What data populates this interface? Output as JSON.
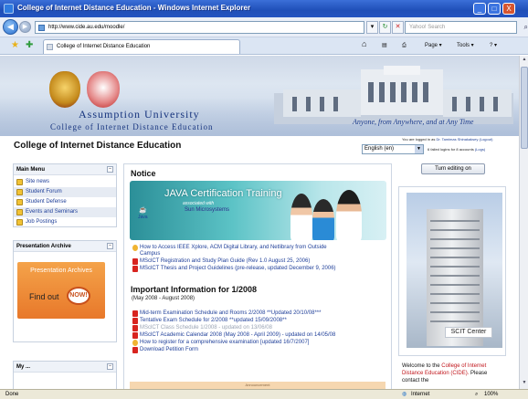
{
  "window": {
    "title": "College of Internet Distance Education - Windows Internet Explorer",
    "min_glyph": "_",
    "max_glyph": "□",
    "close_glyph": "X"
  },
  "address_bar": {
    "back_glyph": "◀",
    "forward_glyph": "▶",
    "url": "http://www.cide.au.edu/moodle/",
    "go_glyph": "▾",
    "refresh_glyph": "↻",
    "stop_glyph": "✕",
    "search_placeholder": "Yahoo! Search",
    "search_glyph": "⌕"
  },
  "tab_bar": {
    "tab_title": "College of Internet Distance Education",
    "home_glyph": "⌂",
    "feeds_glyph": "▤",
    "print_glyph": "⎙",
    "page_label": "Page ▾",
    "tools_label": "Tools ▾",
    "help_glyph": "? ▾"
  },
  "banner": {
    "university_name": "Assumption University",
    "college_name": "College of Internet Distance Education",
    "slogan": "Anyone, from Anywhere, and at Any Time"
  },
  "header": {
    "site_name": "College of Internet Distance Education",
    "login_text": "You are logged in as",
    "login_user": "Dr. Tamimas Shinakaksey (Logout)",
    "language": "English (en)",
    "failed_logins": "6 failed logins for 8 accounts",
    "failed_logins_link": "(Logs)"
  },
  "main_menu": {
    "title": "Main Menu",
    "items": [
      {
        "label": "Site news"
      },
      {
        "label": "Student Forum"
      },
      {
        "label": "Student Defense"
      },
      {
        "label": "Events and Seminars"
      },
      {
        "label": "Job Postings"
      }
    ]
  },
  "presentation_archive": {
    "title": "Presentation Archive",
    "banner_title": "Presentation Archives",
    "find_out": "Find out",
    "now": "NOW!"
  },
  "my_block": {
    "title": "My ..."
  },
  "notice": {
    "title": "Notice",
    "java_title": "JAVA Certification Training",
    "java_associated": "associated with",
    "java_partner": "Sun Microsystems",
    "java_logo": "Java",
    "links": [
      "How to Access IEEE Xplore, ACM Digital Library, and Netlibrary from Outside",
      "Campus",
      "MSclCT Registration and Study Plan Guide (Rev 1.0 August 25, 2006)",
      "MSclCT Thesis and Project Guidelines (pre-release, updated December 9, 2006)"
    ]
  },
  "important": {
    "title": "Important Information for 1/2008",
    "subtitle": "(May 2008 - August 2008)",
    "links": [
      "Mid-term Examination Schedule and Rooms 2/2008 **Updated 20/10/08***",
      "Tentative Exam Schedule for 2/2008 **updated 15/09/2008**",
      "MSclCT Class Schedule 1/2008 - updated on 13/06/08",
      "MSclCT Academic Calendar 2008 (May 2008 - April 2009) - updated on 14/05/08",
      "How to register for a comprehensive examination [updated 16/7/2007]",
      "Download Petition Form"
    ],
    "footer_banner": "Announcement"
  },
  "right": {
    "edit_button": "Turn editing on",
    "photo_caption": "SCIT Center",
    "welcome_prefix": "Welcome to the",
    "welcome_college": "College of Internet Distance Education (CIDE).",
    "welcome_suffix": "Please contact the"
  },
  "status": {
    "left": "Done",
    "zone": "Internet",
    "zoom": "100%"
  },
  "colors": {
    "link": "#1f3f99",
    "accent_red": "#c0141a",
    "titlebar": "#2354c0"
  }
}
